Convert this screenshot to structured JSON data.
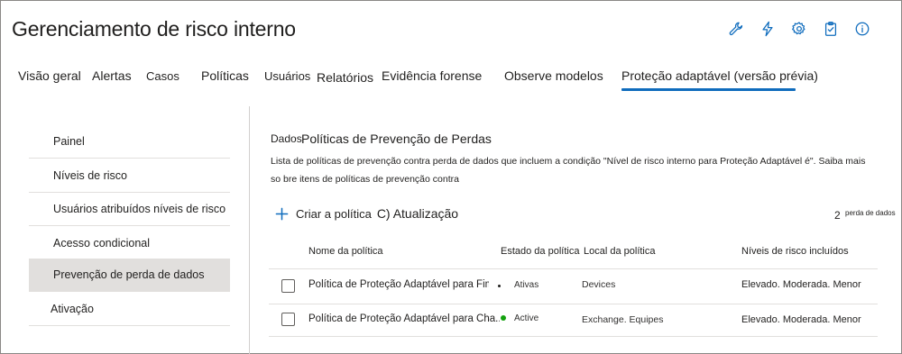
{
  "page": {
    "title": "Gerenciamento de risco interno"
  },
  "header_icons": [
    {
      "name": "wrench-icon"
    },
    {
      "name": "lightning-icon"
    },
    {
      "name": "gear-icon"
    },
    {
      "name": "clipboard-icon"
    },
    {
      "name": "info-icon"
    }
  ],
  "tabs": [
    {
      "label": "Visão geral"
    },
    {
      "label": "Alertas"
    },
    {
      "label": "Casos"
    },
    {
      "label": "Políticas"
    },
    {
      "label": "Usuários"
    },
    {
      "label": "Relatórios"
    },
    {
      "label": "Evidência forense"
    },
    {
      "label": "Observe modelos"
    },
    {
      "label": "Proteção adaptável (versão prévia)",
      "active": true
    }
  ],
  "sidebar": {
    "items": [
      {
        "label": "Painel"
      },
      {
        "label": "Níveis de risco"
      },
      {
        "label": "Usuários atribuídos níveis de risco"
      },
      {
        "label": "Acesso condicional"
      },
      {
        "label": "Prevenção de perda de dados",
        "selected": true
      },
      {
        "label": "Ativação"
      }
    ]
  },
  "main": {
    "section_label": "Dados",
    "section_title": "Políticas de Prevenção de Perdas",
    "description": "Lista de políticas de prevenção contra perda de dados que incluem a condição \"Nível de risco interno para Proteção Adaptável é\". Saiba mais so bre itens de políticas de prevenção contra",
    "toolbar": {
      "create_label": "Criar a política",
      "refresh_label": "C) Atualização"
    },
    "count": {
      "value": "2",
      "label": "perda de dados"
    },
    "table": {
      "columns": [
        "Nome da política",
        "Estado da política",
        "Local da política",
        "Níveis de risco incluídos"
      ],
      "rows": [
        {
          "name": "Política de Proteção Adaptável para Fim...",
          "state": "Ativas",
          "location": "Devices",
          "levels": "Elevado. Moderada. Menor"
        },
        {
          "name": "Política de Proteção Adaptável para Cha...",
          "state": "Active",
          "location": "Exchange. Equipes",
          "levels": "Elevado. Moderada. Menor"
        }
      ]
    }
  },
  "colors": {
    "accent": "#0f6cbd",
    "selected_bg": "#e1dfdd",
    "status_active": "#13a10e"
  }
}
